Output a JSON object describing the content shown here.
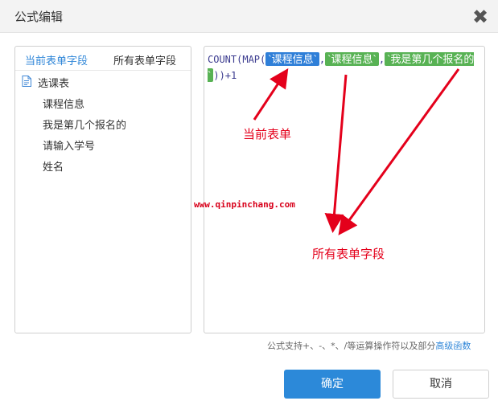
{
  "window": {
    "title": "公式编辑",
    "close_label": "✖"
  },
  "left_panel": {
    "tabs": [
      {
        "label": "当前表单字段",
        "active": true
      },
      {
        "label": "所有表单字段",
        "active": false
      }
    ],
    "form_name": "选课表",
    "fields": [
      "课程信息",
      "我是第几个报名的",
      "请输入学号",
      "姓名"
    ]
  },
  "editor": {
    "formula_prefix": "COUNT(MAP(",
    "field_pill_1": "`课程信息`",
    "separator_1": ",",
    "field_pill_2": "`课程信息`",
    "separator_2": ",",
    "field_pill_3": "`我是第几个报名的`",
    "formula_suffix": "))+1"
  },
  "annotations": {
    "current_form": "当前表单",
    "all_fields": "所有表单字段",
    "watermark": "www.qinpinchang.com"
  },
  "hint": {
    "text": "公式支持+、-、*、/等运算操作符以及部分",
    "link": "高级函数"
  },
  "buttons": {
    "confirm": "确定",
    "cancel": "取消"
  },
  "colors": {
    "accent": "#2c89d9",
    "annotation": "#e4001b",
    "pill_blue": "#2f7fd8",
    "pill_green": "#58b254"
  },
  "icons": {
    "close": "close-icon",
    "form": "document-icon"
  }
}
